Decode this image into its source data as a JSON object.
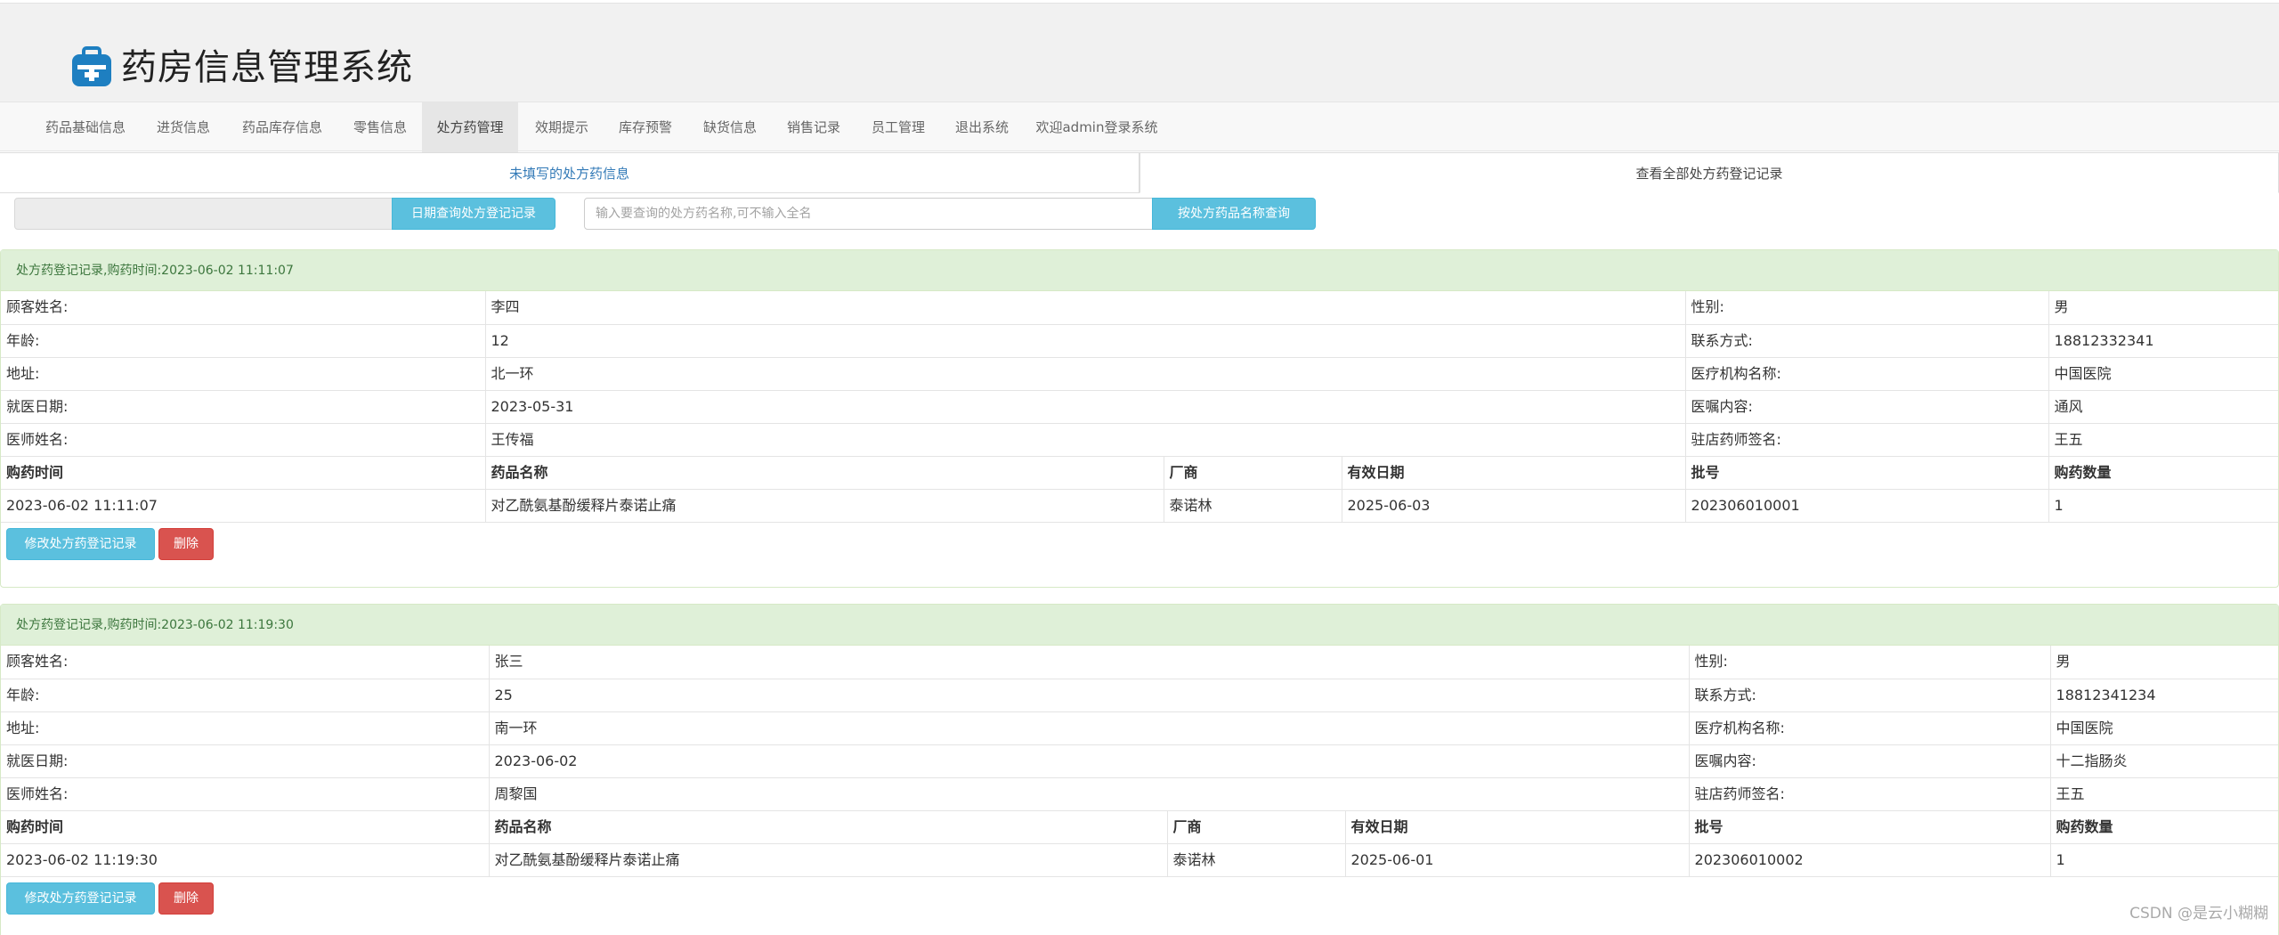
{
  "header": {
    "title": "药房信息管理系统",
    "icon": "medical-kit-icon"
  },
  "nav": {
    "items": [
      "药品基础信息",
      "进货信息",
      "药品库存信息",
      "零售信息",
      "处方药管理",
      "效期提示",
      "库存预警",
      "缺货信息",
      "销售记录",
      "员工管理",
      "退出系统",
      "欢迎admin登录系统"
    ],
    "active_index": 4
  },
  "tabs": {
    "left": "未填写的处方药信息",
    "right": "查看全部处方药登记记录"
  },
  "search": {
    "date_value": "",
    "date_button": "日期查询处方登记记录",
    "name_placeholder": "输入要查询的处方药名称,可不输入全名",
    "name_button": "按处方药品名称查询"
  },
  "labels": {
    "customer_name": "顾客姓名:",
    "gender": "性别:",
    "age": "年龄:",
    "contact": "联系方式:",
    "address": "地址:",
    "institution": "医疗机构名称:",
    "visit_date": "就医日期:",
    "advice": "医嘱内容:",
    "doctor": "医师姓名:",
    "pharmacist": "驻店药师签名:"
  },
  "columns": [
    "购药时间",
    "药品名称",
    "厂商",
    "有效日期",
    "批号",
    "购药数量"
  ],
  "records": [
    {
      "heading": "处方药登记记录,购药时间:2023-06-02 11:11:07",
      "customer_name": "李四",
      "gender": "男",
      "age": "12",
      "contact": "18812332341",
      "address": "北一环",
      "institution": "中国医院",
      "visit_date": "2023-05-31",
      "advice": "通风",
      "doctor": "王传福",
      "pharmacist": "王五",
      "purchase": {
        "time": "2023-06-02 11:11:07",
        "drug": "对乙酰氨基酚缓释片泰诺止痛",
        "maker": "泰诺林",
        "expiry": "2025-06-03",
        "batch": "202306010001",
        "quantity": "1"
      },
      "edit_label": "修改处方药登记记录",
      "delete_label": "删除"
    },
    {
      "heading": "处方药登记记录,购药时间:2023-06-02 11:19:30",
      "customer_name": "张三",
      "gender": "男",
      "age": "25",
      "contact": "18812341234",
      "address": "南一环",
      "institution": "中国医院",
      "visit_date": "2023-06-02",
      "advice": "十二指肠炎",
      "doctor": "周黎国",
      "pharmacist": "王五",
      "purchase": {
        "time": "2023-06-02 11:19:30",
        "drug": "对乙酰氨基酚缓释片泰诺止痛",
        "maker": "泰诺林",
        "expiry": "2025-06-01",
        "batch": "202306010002",
        "quantity": "1"
      },
      "edit_label": "修改处方药登记记录",
      "delete_label": "删除"
    }
  ],
  "watermark": "CSDN @是云小糊糊",
  "colors": {
    "accent": "#5bc0de",
    "danger": "#d9534f",
    "panel_heading": "#dff0d8",
    "panel_text": "#3c763d",
    "link": "#337ab7"
  }
}
